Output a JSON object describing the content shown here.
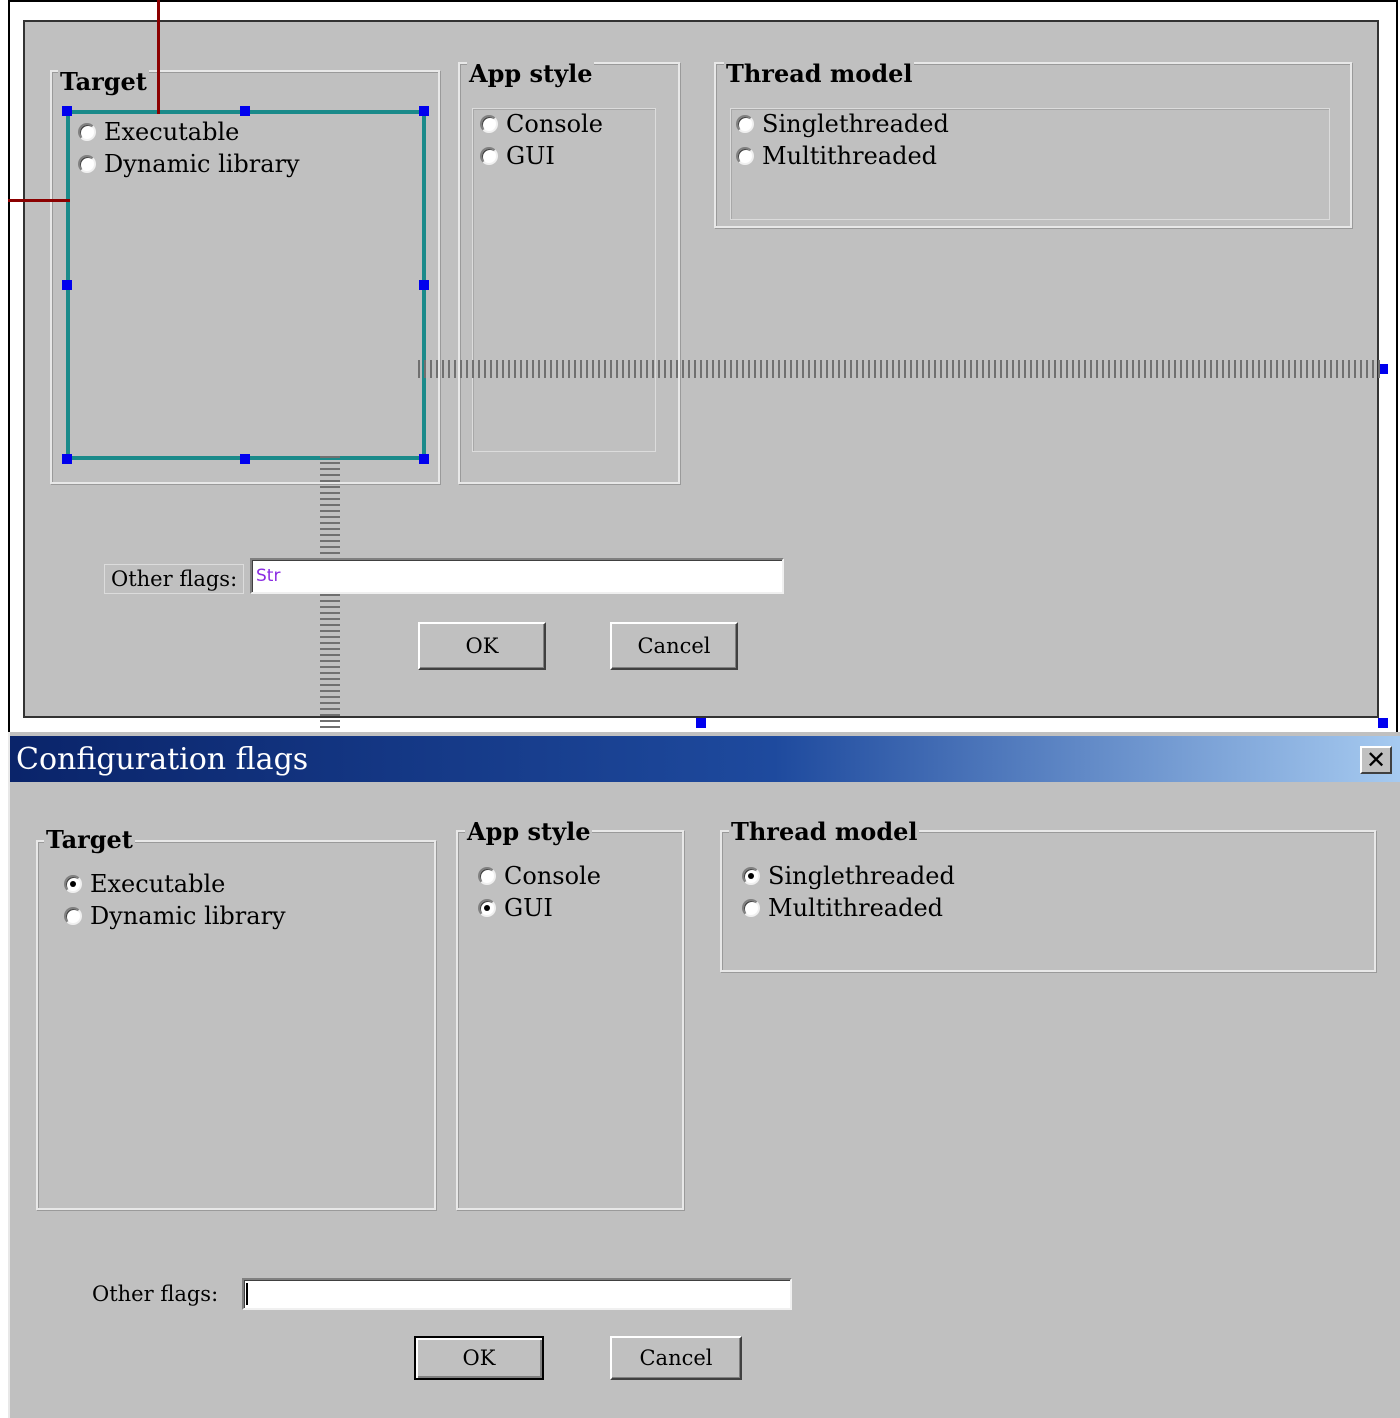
{
  "designer": {
    "target": {
      "legend": "Target",
      "options": [
        "Executable",
        "Dynamic library"
      ]
    },
    "app_style": {
      "legend": "App style",
      "options": [
        "Console",
        "GUI"
      ]
    },
    "thread_model": {
      "legend": "Thread model",
      "options": [
        "Singlethreaded",
        "Multithreaded"
      ]
    },
    "other_flags_label": "Other flags:",
    "other_flags_value": "Str",
    "ok_label": "OK",
    "cancel_label": "Cancel"
  },
  "dialog": {
    "title": "Configuration flags",
    "close_glyph": "✕",
    "target": {
      "legend": "Target",
      "options": [
        "Executable",
        "Dynamic library"
      ],
      "selected": "Executable"
    },
    "app_style": {
      "legend": "App style",
      "options": [
        "Console",
        "GUI"
      ],
      "selected": "GUI"
    },
    "thread_model": {
      "legend": "Thread model",
      "options": [
        "Singlethreaded",
        "Multithreaded"
      ],
      "selected": "Singlethreaded"
    },
    "other_flags_label": "Other flags:",
    "other_flags_value": "",
    "ok_label": "OK",
    "cancel_label": "Cancel"
  },
  "colors": {
    "face": "#c0c0c0",
    "titlebar_start": "#0a246a",
    "titlebar_end": "#a6caf0",
    "selection_border": "#1a8a8a",
    "handle": "#0000ee",
    "guide": "#8b0000",
    "str_text": "#8a2be2"
  }
}
